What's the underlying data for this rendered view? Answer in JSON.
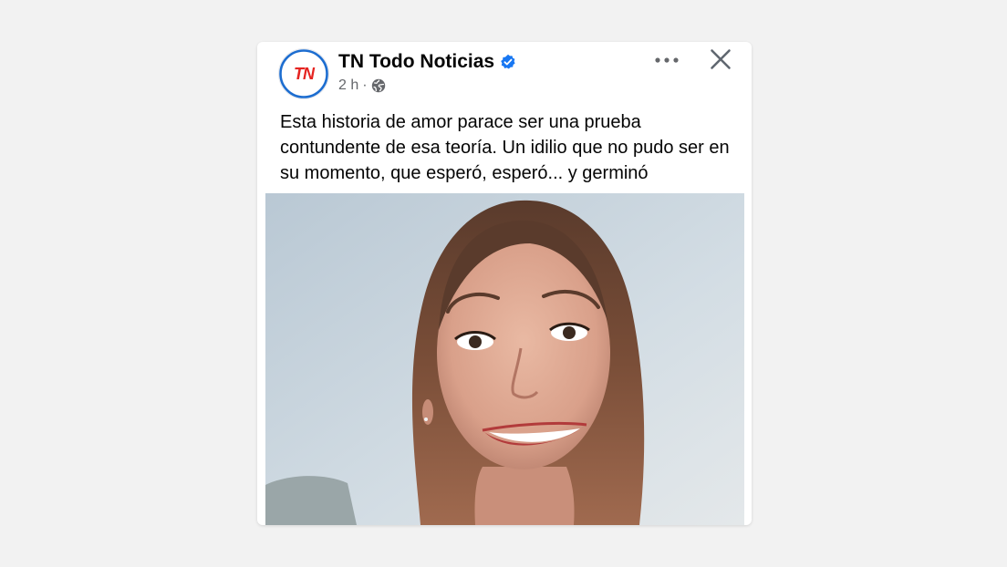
{
  "post": {
    "author": "TN Todo Noticias",
    "avatar_text": "TN",
    "timestamp": "2 h",
    "separator": "·",
    "privacy_icon": "globe-icon",
    "verified_icon": "verified-badge-icon",
    "more_icon": "more-options-icon",
    "close_icon": "close-icon",
    "text": "Esta historia de amor parace ser una prueba contundente de esa teoría. Un idilio que no pudo ser en su momento, que esperó, esperó... y germinó"
  },
  "colors": {
    "verified": "#1877f2",
    "avatar_ring": "#1c6dd0",
    "tn_red": "#e52421",
    "tn_blue": "#1f5fbf",
    "background": "#f2f2f2"
  }
}
